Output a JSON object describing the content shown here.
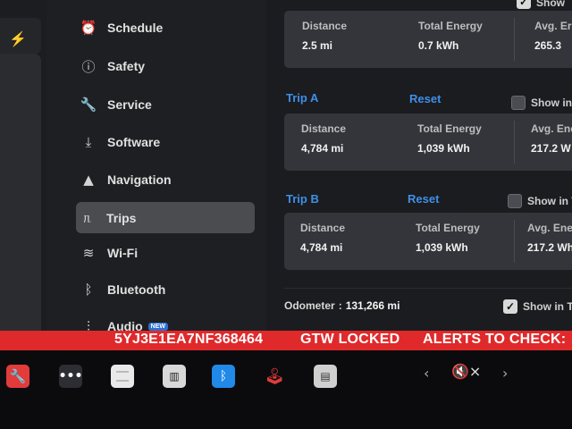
{
  "menu": {
    "items": [
      {
        "label": "Schedule",
        "icon": "clock-icon",
        "glyph": "⏰"
      },
      {
        "label": "Safety",
        "icon": "alert-circle-icon",
        "glyph": "ⓘ"
      },
      {
        "label": "Service",
        "icon": "wrench-icon",
        "glyph": "🔧"
      },
      {
        "label": "Software",
        "icon": "download-icon",
        "glyph": "⤓"
      },
      {
        "label": "Navigation",
        "icon": "navigation-arrow-icon",
        "glyph": "▲"
      },
      {
        "label": "Trips",
        "icon": "trips-icon",
        "glyph": "ᥰ"
      },
      {
        "label": "Wi-Fi",
        "icon": "wifi-icon",
        "glyph": "≋"
      },
      {
        "label": "Bluetooth",
        "icon": "bluetooth-icon",
        "glyph": "ᛒ"
      },
      {
        "label": "Audio",
        "icon": "audio-sliders-icon",
        "glyph": "⫶",
        "badge": "NEW"
      }
    ]
  },
  "since_charge": {
    "distance_label": "Distance",
    "distance": "2.5 mi",
    "energy_label": "Total Energy",
    "energy": "0.7 kWh",
    "avg_label": "Avg. Er",
    "avg": "265.3",
    "show_label": "Show"
  },
  "trip_a": {
    "title": "Trip A",
    "reset": "Reset",
    "show_label": "Show in",
    "distance_label": "Distance",
    "distance": "4,784 mi",
    "energy_label": "Total Energy",
    "energy": "1,039 kWh",
    "avg_label": "Avg. Ene",
    "avg": "217.2 W"
  },
  "trip_b": {
    "title": "Trip B",
    "reset": "Reset",
    "show_label": "Show in T",
    "distance_label": "Distance",
    "distance": "4,784 mi",
    "energy_label": "Total Energy",
    "energy": "1,039 kWh",
    "avg_label": "Avg. Ene",
    "avg": "217.2 Wh"
  },
  "odometer": {
    "label": "Odometer",
    "sep": ":",
    "value": "131,266 mi",
    "show_label": "Show in Tr"
  },
  "banner": {
    "vin": "5YJ3E1EA7NF368464",
    "gtw": "GTW LOCKED",
    "alerts": "ALERTS TO CHECK:"
  },
  "taskbar": {
    "left_arrow": "‹",
    "right_arrow": "›",
    "mute": "🔇×"
  },
  "colors": {
    "accent": "#3f8fe8",
    "banner": "#e0292b",
    "active_item": "#4b4c50"
  }
}
